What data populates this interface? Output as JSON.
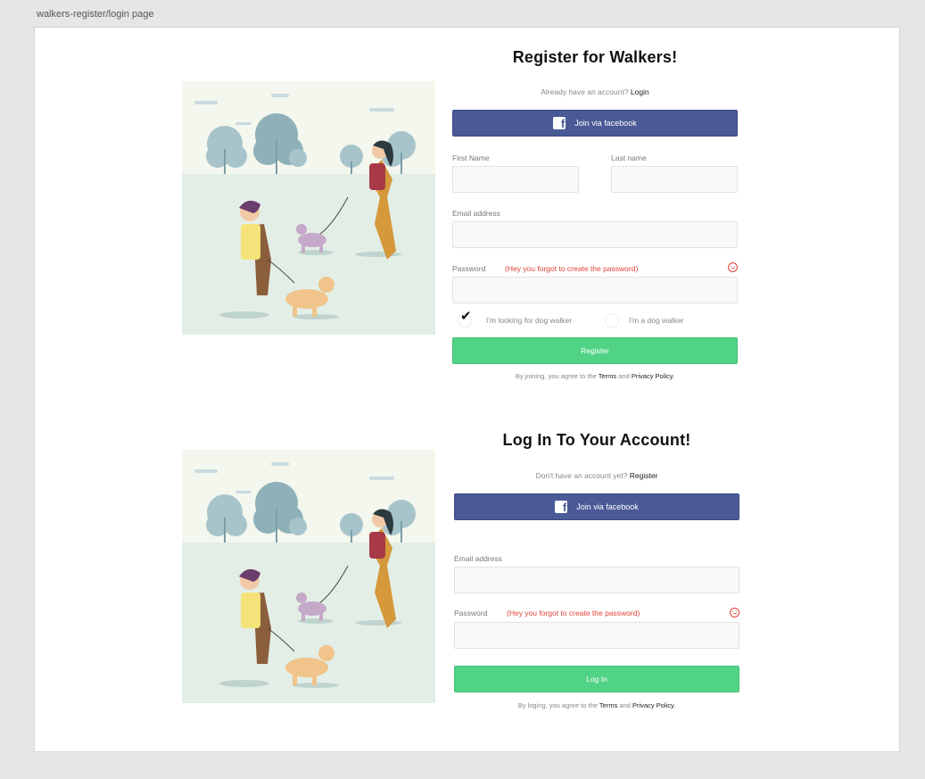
{
  "page_label": "walkers-register/login page",
  "register": {
    "title": "Register for Walkers!",
    "have_account_text": "Already have an account?",
    "login_link": "Login",
    "facebook_label": "Join via facebook",
    "first_name_label": "First Name",
    "last_name_label": "Last name",
    "email_label": "Email address",
    "password_label": "Password",
    "password_error": "(Hey you forgot to create the password)",
    "radio_looking_label": "I'm looking for dog walker",
    "radio_walker_label": "I'm a dog walker",
    "submit_label": "Register",
    "terms_prefix": "By joining, you agree to the",
    "terms_link": "Terms",
    "terms_and": "and",
    "privacy_link": "Privacy Policy."
  },
  "login": {
    "title": "Log In To Your Account!",
    "no_account_text": "Don't have an account yet?",
    "register_link": "Register",
    "facebook_label": "Join via facebook",
    "email_label": "Email address",
    "password_label": "Password",
    "password_error": "(Hey you forgot to create the password)",
    "submit_label": "Log In",
    "terms_prefix": "By loging, you agree to the",
    "terms_link": "Terms",
    "terms_and": "and",
    "privacy_link": "Privacy Policy."
  },
  "icons": {
    "facebook": "facebook-icon",
    "error": "sad-face-icon",
    "check": "checkmark-icon"
  },
  "colors": {
    "facebook": "#4a5a96",
    "primary_green": "#50d384",
    "error_red": "#e0443b"
  }
}
